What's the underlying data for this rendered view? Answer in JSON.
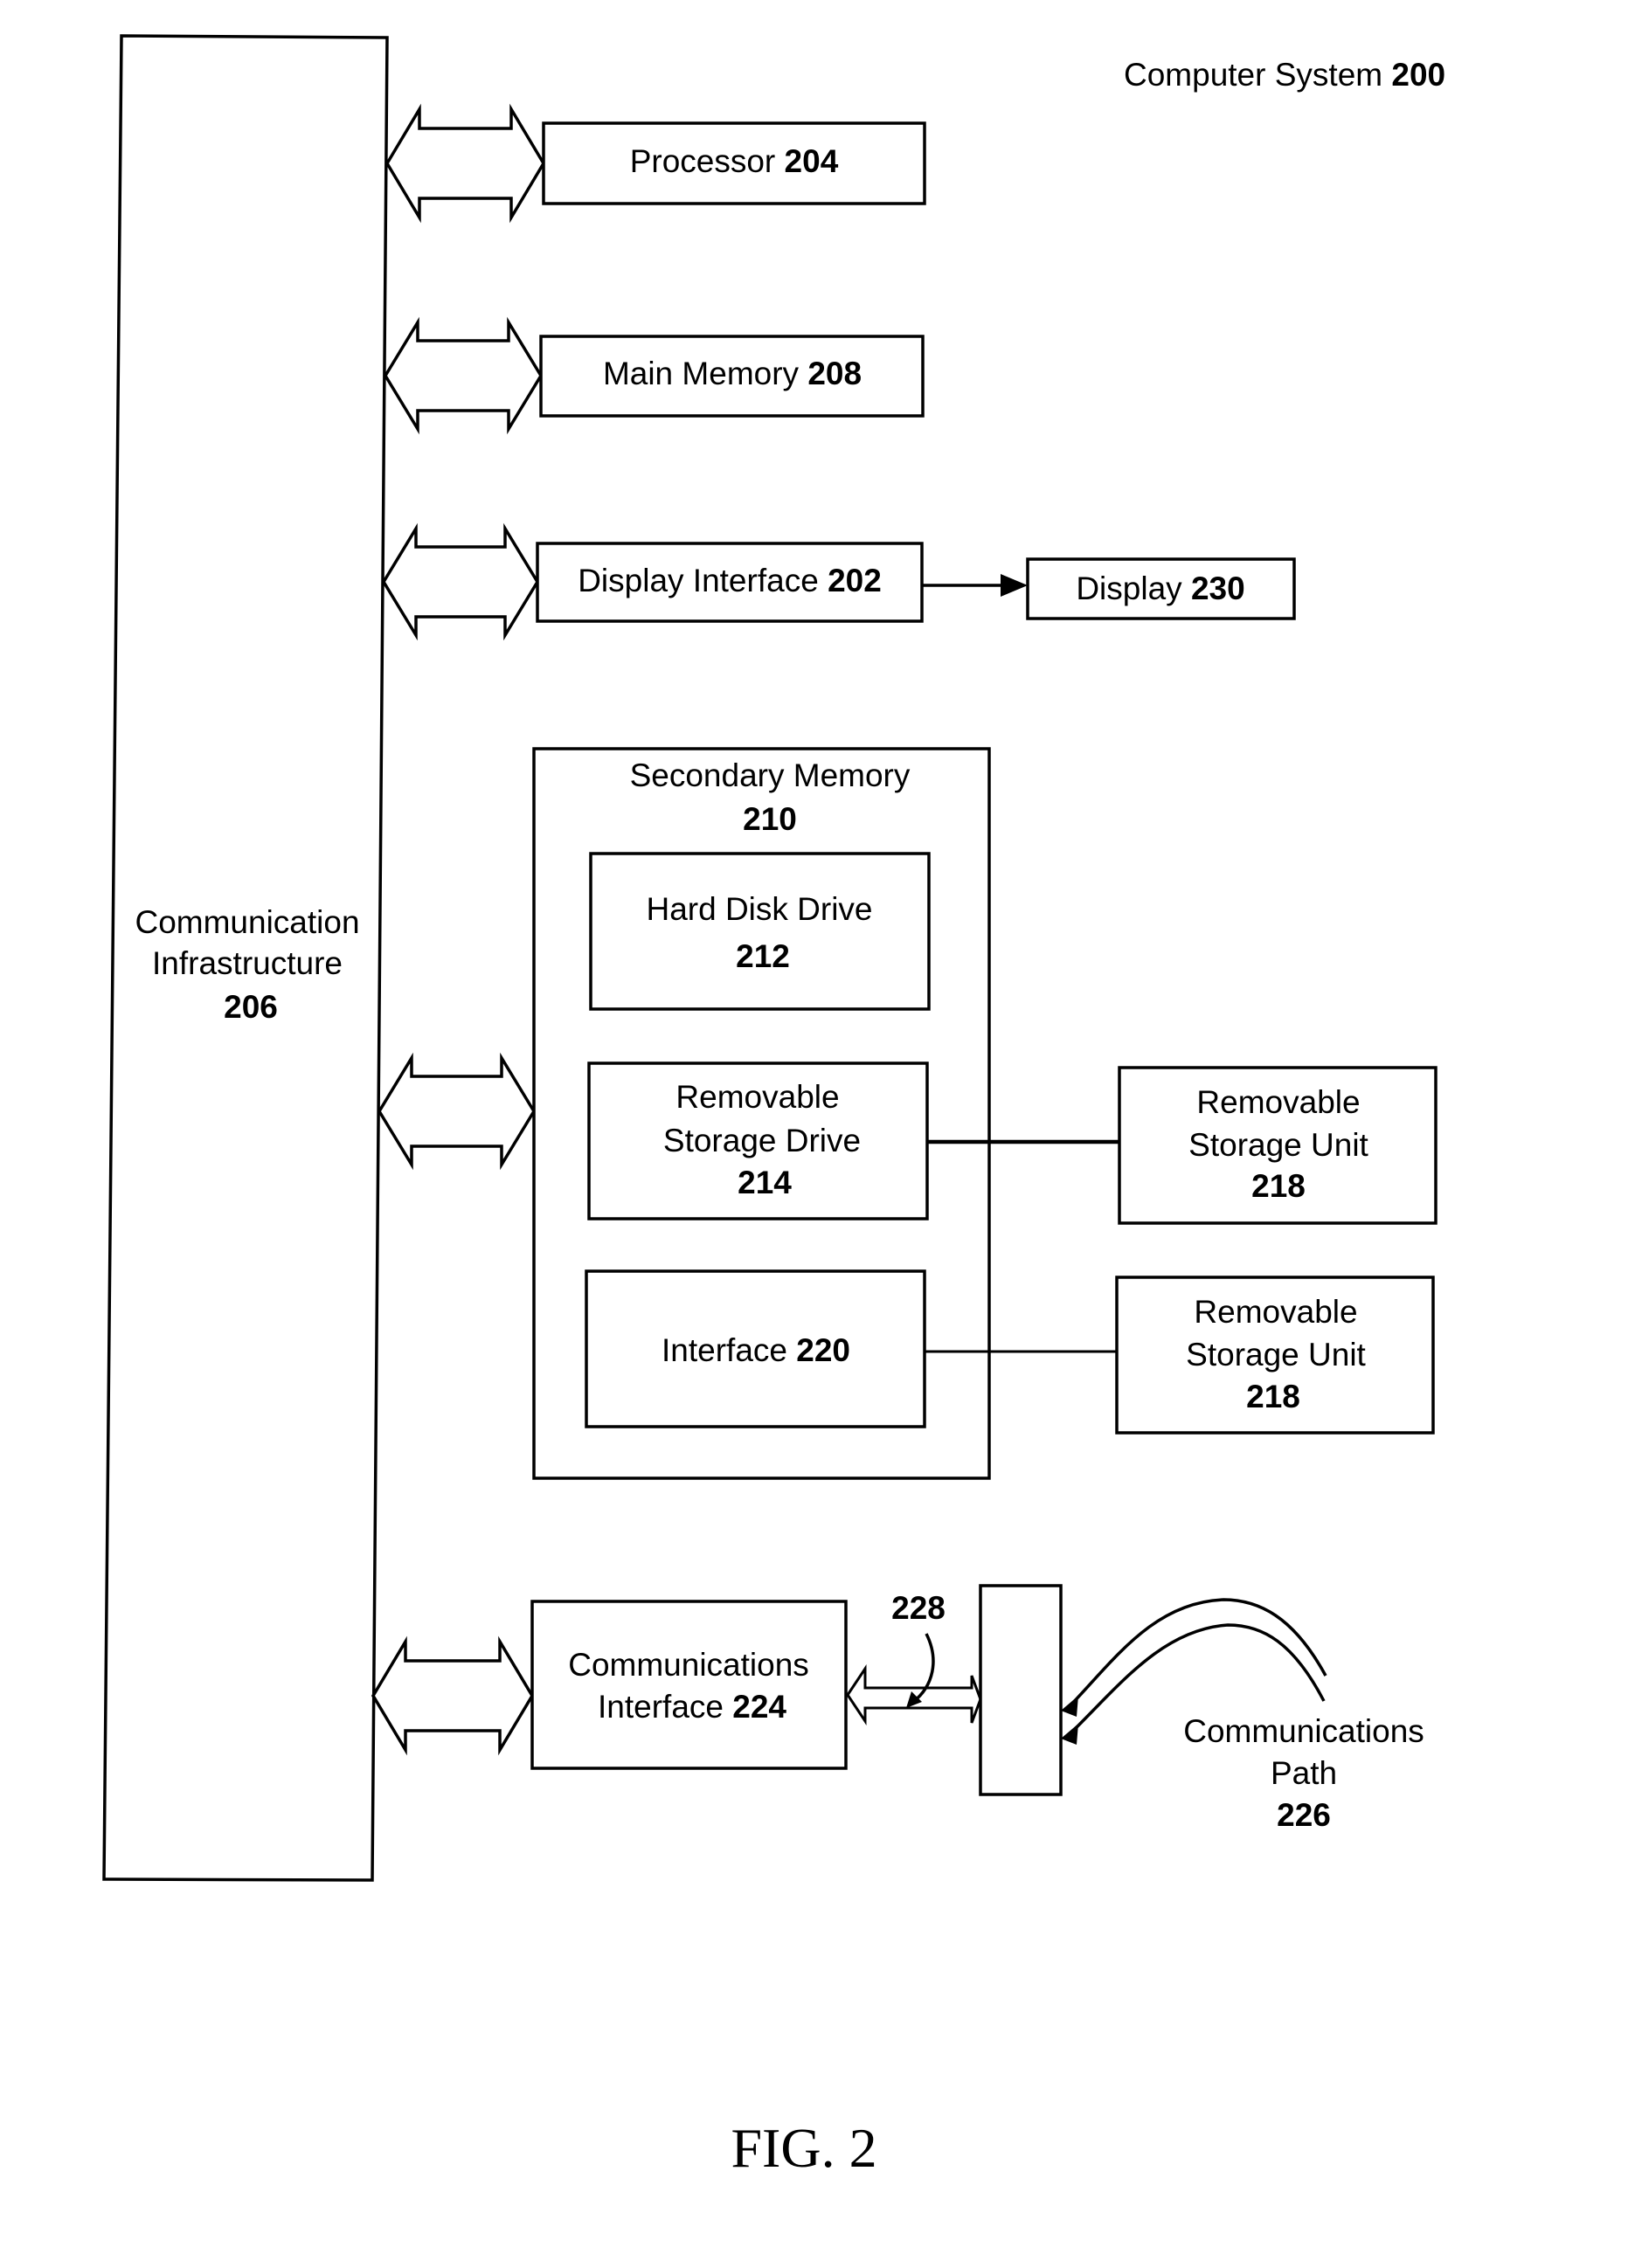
{
  "title": {
    "text": "Computer System",
    "number": "200"
  },
  "figure_label": "FIG. 2",
  "components": {
    "communication_infrastructure": {
      "lines": [
        "Communication",
        "Infrastructure"
      ],
      "number": "206"
    },
    "processor": {
      "text": "Processor",
      "number": "204"
    },
    "main_memory": {
      "text": "Main Memory",
      "number": "208"
    },
    "display_interface": {
      "text": "Display Interface",
      "number": "202"
    },
    "display": {
      "text": "Display",
      "number": "230"
    },
    "secondary_memory": {
      "text": "Secondary Memory",
      "number": "210"
    },
    "hard_disk_drive": {
      "text": "Hard Disk Drive",
      "number": "212"
    },
    "removable_storage_drive": {
      "lines": [
        "Removable",
        "Storage Drive"
      ],
      "number": "214"
    },
    "interface": {
      "text": "Interface",
      "number": "220"
    },
    "removable_storage_unit_1": {
      "lines": [
        "Removable",
        "Storage Unit"
      ],
      "number": "218"
    },
    "removable_storage_unit_2": {
      "lines": [
        "Removable",
        "Storage Unit"
      ],
      "number": "218"
    },
    "communications_interface": {
      "lines": [
        "Communications",
        "Interface"
      ],
      "number": "224"
    },
    "communications_path": {
      "lines": [
        "Communications",
        "Path"
      ],
      "number": "226"
    },
    "channel_label": "228"
  },
  "connections": [
    {
      "from": "communication_infrastructure",
      "to": "processor",
      "type": "bidirectional-bus"
    },
    {
      "from": "communication_infrastructure",
      "to": "main_memory",
      "type": "bidirectional-bus"
    },
    {
      "from": "communication_infrastructure",
      "to": "display_interface",
      "type": "bidirectional-bus"
    },
    {
      "from": "communication_infrastructure",
      "to": "secondary_memory",
      "type": "bidirectional-bus"
    },
    {
      "from": "communication_infrastructure",
      "to": "communications_interface",
      "type": "bidirectional-bus"
    },
    {
      "from": "display_interface",
      "to": "display",
      "type": "arrow"
    },
    {
      "from": "removable_storage_drive",
      "to": "removable_storage_unit_1",
      "type": "line"
    },
    {
      "from": "interface",
      "to": "removable_storage_unit_2",
      "type": "line"
    },
    {
      "from": "communications_interface",
      "to": "port",
      "type": "bidirectional-channel",
      "label": "228"
    },
    {
      "from": "communications_path",
      "to": "port",
      "type": "curved-arrows"
    }
  ]
}
